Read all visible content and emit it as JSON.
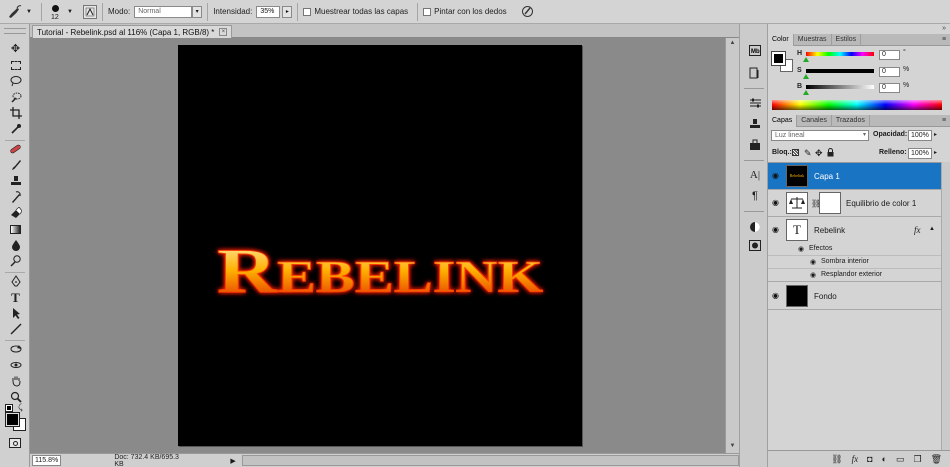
{
  "options_bar": {
    "brush_size": "12",
    "mode_label": "Modo:",
    "mode_value": "Normal",
    "intensity_label": "Intensidad:",
    "intensity_value": "35%",
    "sample_all_layers_label": "Muestrear todas las capas",
    "finger_painting_label": "Pintar con los dedos"
  },
  "document": {
    "tab_title": "Tutorial - Rebelink.psd al 116% (Capa 1, RGB/8) *",
    "close_glyph": "×",
    "canvas_text": "Rebelink"
  },
  "status": {
    "zoom": "115.8%",
    "doc_info": "Doc: 732.4 KB/695.3 KB",
    "arrow": "▶"
  },
  "color_panel": {
    "tabs": [
      "Color",
      "Muestras",
      "Estilos"
    ],
    "channels": [
      {
        "label": "H",
        "value": "0",
        "unit": "°",
        "fraction": 0.0
      },
      {
        "label": "S",
        "value": "0",
        "unit": "%",
        "fraction": 0.0
      },
      {
        "label": "B",
        "value": "0",
        "unit": "%",
        "fraction": 0.0
      }
    ],
    "foreground_color": "#000000",
    "background_color": "#ffffff"
  },
  "layers_panel": {
    "tabs": [
      "Capas",
      "Canales",
      "Trazados"
    ],
    "blend_mode": "Luz lineal",
    "opacity_label": "Opacidad:",
    "opacity_value": "100%",
    "lock_label": "Bloq.:",
    "fill_label": "Relleno:",
    "fill_value": "100%",
    "thumb_text": "Rebelink",
    "layers": [
      {
        "name": "Capa 1",
        "selected": true
      },
      {
        "name": "Equilibrio de color 1",
        "selected": false
      },
      {
        "name": "Rebelink",
        "selected": false,
        "fx": "fx"
      },
      {
        "name": "Fondo",
        "selected": false
      }
    ],
    "effects_label": "Efectos",
    "effects": [
      "Sombra interior",
      "Resplandor exterior"
    ]
  },
  "colors": {
    "selection": "#1a74c4",
    "fire_core": "#fff2c0",
    "fire_mid": "#ffb000",
    "fire_edge": "#e02000"
  }
}
